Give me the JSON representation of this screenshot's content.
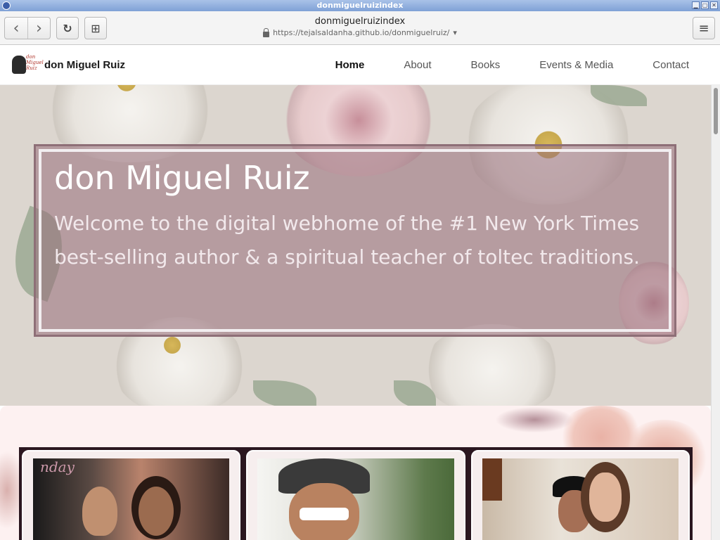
{
  "window": {
    "title": "donmiguelruizindex"
  },
  "browser": {
    "page_title": "donmiguelruizindex",
    "url": "https://tejalsaldanha.github.io/donmiguelruiz/",
    "url_dropdown_glyph": "▾",
    "buttons": {
      "back": "‹",
      "forward": "›",
      "reload": "↻",
      "new_tab": "⊞",
      "menu": "≡"
    }
  },
  "site": {
    "brand_name": "don Miguel Ruiz",
    "logo_text": "don\nMiguel\nRuiz",
    "nav": [
      {
        "label": "Home",
        "active": true
      },
      {
        "label": "About",
        "active": false
      },
      {
        "label": "Books",
        "active": false
      },
      {
        "label": "Events & Media",
        "active": false
      },
      {
        "label": "Contact",
        "active": false
      }
    ]
  },
  "hero": {
    "title": "don Miguel Ruiz",
    "subtitle": "Welcome to the digital webhome of the #1 New York Times best-selling author & a spiritual teacher of toltec traditions."
  },
  "cards": [
    {
      "icon": "photo-oprah-interview"
    },
    {
      "icon": "photo-don-miguel-portrait"
    },
    {
      "icon": "photo-group-with-maria-shriver"
    }
  ],
  "colors": {
    "hero_overlay": "#986e7a",
    "hero_border": "#8e6f77",
    "lower_bg": "#fdf1f1",
    "cards_frame": "#2b1720",
    "titlebar": "#7fa1d6"
  }
}
